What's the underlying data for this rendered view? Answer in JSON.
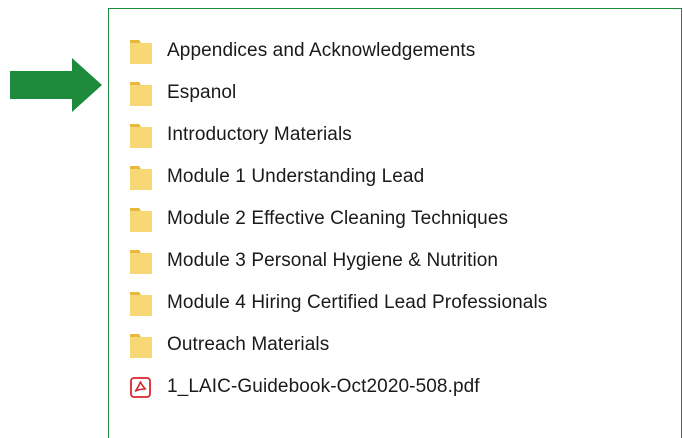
{
  "arrow": {
    "color": "#1e8a3c",
    "icon": "arrow-right-icon"
  },
  "panel": {
    "border_color": "#1e8a3c"
  },
  "items": [
    {
      "type": "folder",
      "icon": "folder-icon",
      "label": "Appendices and Acknowledgements"
    },
    {
      "type": "folder",
      "icon": "folder-icon",
      "label": "Espanol"
    },
    {
      "type": "folder",
      "icon": "folder-icon",
      "label": "Introductory Materials"
    },
    {
      "type": "folder",
      "icon": "folder-icon",
      "label": "Module 1 Understanding Lead"
    },
    {
      "type": "folder",
      "icon": "folder-icon",
      "label": "Module 2 Effective Cleaning Techniques"
    },
    {
      "type": "folder",
      "icon": "folder-icon",
      "label": "Module 3 Personal Hygiene & Nutrition"
    },
    {
      "type": "folder",
      "icon": "folder-icon",
      "label": "Module 4 Hiring Certified Lead Professionals"
    },
    {
      "type": "folder",
      "icon": "folder-icon",
      "label": "Outreach Materials"
    },
    {
      "type": "pdf",
      "icon": "pdf-file-icon",
      "label": "1_LAIC-Guidebook-Oct2020-508.pdf"
    }
  ],
  "colors": {
    "folder": "#f8d775",
    "folder_dark": "#e8b83d",
    "pdf_red": "#d9262b"
  }
}
